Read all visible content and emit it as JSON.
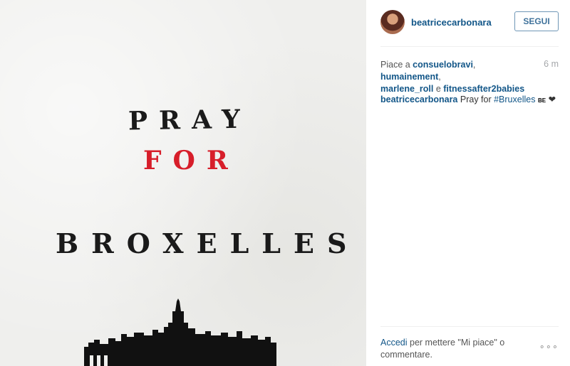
{
  "post": {
    "image": {
      "line1": "PRAY",
      "line2": "FOR",
      "line3": "BROXELLES"
    }
  },
  "header": {
    "username": "beatricecarbonara",
    "follow_label": "SEGUI"
  },
  "likes": {
    "prefix": "Piace a ",
    "users": [
      "consuelobravi",
      "humainement",
      "marlene_roll",
      "fitnessafter2babies"
    ],
    "sep1": ", ",
    "sep2": ",",
    "conj": " e ",
    "time": "6 m"
  },
  "caption": {
    "username": "beatricecarbonara",
    "text": " Pray for ",
    "hashtag": "#Bruxelles",
    "flag": "BE",
    "heart": "❤"
  },
  "footer": {
    "link": "Accedi",
    "rest": " per mettere \"Mi piace\" o commentare.",
    "more": "∘∘∘"
  }
}
